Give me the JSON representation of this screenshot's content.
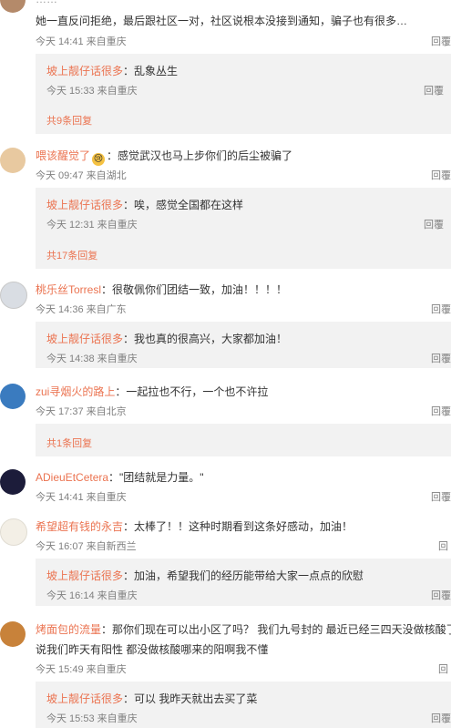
{
  "comments": [
    {
      "top_fragment": "……",
      "text": "她一直反问拒绝，最后跟社区一对，社区说根本没接到通知，骗子也有很多…",
      "time": "今天 14:41 来自重庆",
      "reply_label": "回覆",
      "sub": {
        "user": "坡上靓仔话很多",
        "text": "：乱象丛生",
        "time": "今天 15:33 来自重庆",
        "reply_label": "回覆"
      },
      "more": "共9条回复"
    },
    {
      "user": "喂该醒觉了",
      "text": "：感觉武汉也马上步你们的后尘被骗了",
      "time": "今天 09:47 来自湖北",
      "reply_label": "回覆",
      "sub": {
        "user": "坡上靓仔话很多",
        "text": "：唉，感觉全国都在这样",
        "time": "今天 12:31 来自重庆",
        "reply_label": "回覆"
      },
      "more": "共17条回复"
    },
    {
      "user": "桃乐丝Torresl",
      "text": "：很敬佩你们团结一致，加油！！！！",
      "time": "今天 14:36 来自广东",
      "reply_label": "回覆",
      "sub": {
        "user": "坡上靓仔话很多",
        "text": "：我也真的很高兴，大家都加油！",
        "time": "今天 14:38 来自重庆",
        "reply_label": "回覆"
      }
    },
    {
      "user": "zui寻烟火的路上",
      "text": "：一起拉也不行，一个也不许拉",
      "time": "今天 17:37 来自北京",
      "reply_label": "回覆",
      "more": "共1条回复"
    },
    {
      "user": "ADieuEtCetera",
      "text": "：\"团结就是力量。\"",
      "time": "今天 14:41 来自重庆",
      "reply_label": "回覆"
    },
    {
      "user": "希望超有钱的永吉",
      "text": "：太棒了！！这种时期看到这条好感动，加油！",
      "time": "今天 16:07 来自新西兰",
      "reply_label": "回",
      "sub": {
        "user": "坡上靓仔话很多",
        "text": "：加油，希望我们的经历能带给大家一点点的欣慰",
        "time": "今天 16:14 来自重庆",
        "reply_label": "回覆"
      }
    },
    {
      "user": "烤面包的流量",
      "text": "：那你们现在可以出小区了吗？ 我们九号封的 最近已经三四天没做核酸了",
      "text2": "说我们昨天有阳性 都没做核酸哪来的阳啊我不懂",
      "time": "今天 15:49 来自重庆",
      "reply_label": "回",
      "sub": {
        "user": "坡上靓仔话很多",
        "text": "：可以 我昨天就出去买了菜",
        "time": "今天 15:53 来自重庆",
        "reply_label": "回覆"
      }
    }
  ]
}
